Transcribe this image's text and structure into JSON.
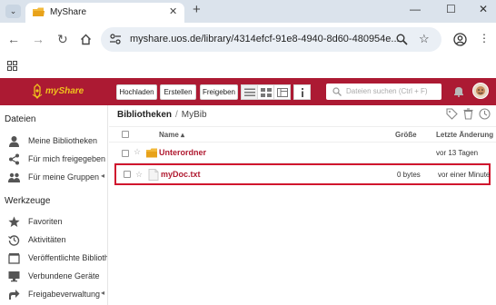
{
  "browser": {
    "tab_title": "MyShare",
    "url": "myshare.uos.de/library/4314efcf-91e8-4940-8d60-480954e..."
  },
  "app": {
    "brand": "myShare",
    "brand_color": "#ac1a33",
    "brand_accent": "#f0c21d",
    "toolbar": {
      "upload_label": "Hochladen",
      "create_label": "Erstellen",
      "share_label": "Freigeben"
    },
    "search": {
      "placeholder": "Dateien suchen (Ctrl + F)"
    }
  },
  "sidebar": {
    "files_heading": "Dateien",
    "files_items": [
      {
        "label": "Meine Bibliotheken",
        "icon": "person-icon"
      },
      {
        "label": "Für mich freigegeben",
        "icon": "share-icon"
      },
      {
        "label": "Für meine Gruppen",
        "icon": "group-icon",
        "arrow": "◂"
      }
    ],
    "tools_heading": "Werkzeuge",
    "tools_items": [
      {
        "label": "Favoriten",
        "icon": "star-icon"
      },
      {
        "label": "Aktivitäten",
        "icon": "history-icon"
      },
      {
        "label": "Veröffentlichte Bibliotheken",
        "icon": "published-icon"
      },
      {
        "label": "Verbundene Geräte",
        "icon": "monitor-icon"
      },
      {
        "label": "Freigabeverwaltung",
        "icon": "share-admin-icon",
        "arrow": "◂"
      }
    ]
  },
  "main": {
    "breadcrumb": {
      "root": "Bibliotheken",
      "separator": "/",
      "current": "MyBib"
    },
    "columns": {
      "name": "Name ▴",
      "size": "Größe",
      "modified": "Letzte Änderung"
    },
    "rows": [
      {
        "name": "Unterordner",
        "type": "folder",
        "size": "",
        "modified": "vor 13 Tagen"
      },
      {
        "name": "myDoc.txt",
        "type": "file",
        "size": "0 bytes",
        "modified": "vor einer Minute",
        "highlighted": true
      }
    ]
  }
}
